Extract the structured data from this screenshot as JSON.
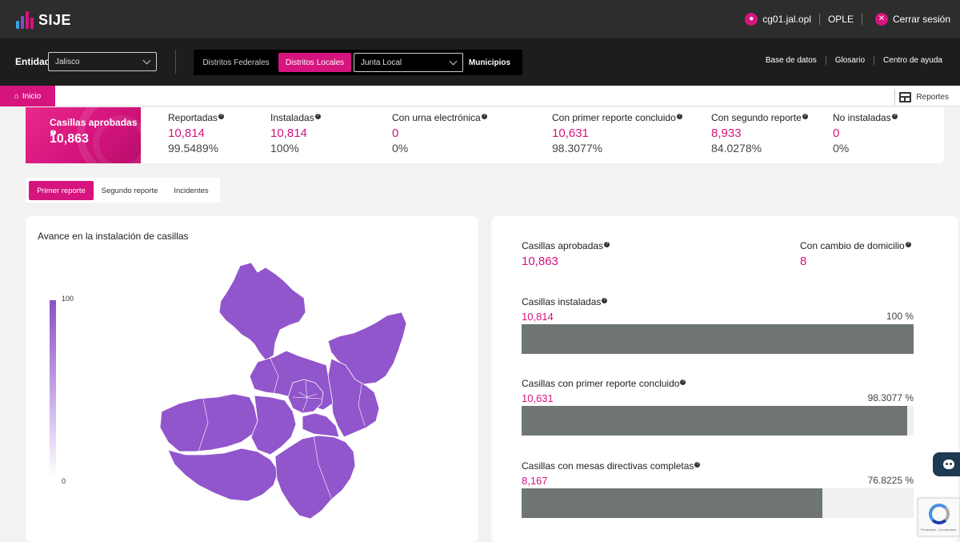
{
  "header": {
    "logo_text": "SIJE",
    "user": "cg01.jal.opl",
    "role": "OPLE",
    "logout_label": "Cerrar sesión",
    "logo_colors": [
      "#3aa0e0",
      "#7b4fc9",
      "#d5147e",
      "#d5147e"
    ]
  },
  "filters": {
    "entidad_label": "Entidad",
    "entidad_value": "Jalisco",
    "distritos_federales": "Distritos Federales",
    "distritos_locales": "Distritos Locales",
    "junta_value": "Junta Local",
    "municipios": "Municipios",
    "links": [
      "Base de datos",
      "Glosario",
      "Centro de ayuda"
    ]
  },
  "nav": {
    "home_label": "Inicio",
    "reportes_label": "Reportes"
  },
  "stats": {
    "featured": {
      "label": "Casillas aprobadas",
      "value": "10,863"
    },
    "items": [
      {
        "label": "Reportadas",
        "value": "10,814",
        "pct": "99.5489%"
      },
      {
        "label": "Instaladas",
        "value": "10,814",
        "pct": "100%"
      },
      {
        "label": "Con urna electrónica",
        "value": "0",
        "pct": "0%"
      },
      {
        "label": "Con primer reporte concluido",
        "value": "10,631",
        "pct": "98.3077%"
      },
      {
        "label": "Con segundo reporte",
        "value": "8,933",
        "pct": "84.0278%"
      },
      {
        "label": "No instaladas",
        "value": "0",
        "pct": "0%"
      }
    ]
  },
  "tabs": [
    "Primer reporte",
    "Segundo reporte",
    "Incidentes"
  ],
  "map_card": {
    "title": "Avance en la instalación de casillas",
    "legend_max": "100",
    "legend_min": "0",
    "fill_color": "#9155cc"
  },
  "detail_card": {
    "aprobadas": {
      "label": "Casillas aprobadas",
      "value": "10,863"
    },
    "domicilio": {
      "label": "Con cambio de domicilio",
      "value": "8"
    },
    "bars": [
      {
        "label": "Casillas instaladas",
        "value": "10,814",
        "pct_label": "100 %",
        "fraction": 1.0
      },
      {
        "label": "Casillas con primer reporte concluido",
        "value": "10,631",
        "pct_label": "98.3077 %",
        "fraction": 0.983077
      },
      {
        "label": "Casillas con mesas directivas completas",
        "value": "8,167",
        "pct_label": "76.8225 %",
        "fraction": 0.768225
      }
    ]
  },
  "recaptcha": {
    "text": "Privacidad - Condiciones"
  },
  "colors": {
    "accent": "#d5147e",
    "bar": "#6f7575"
  }
}
